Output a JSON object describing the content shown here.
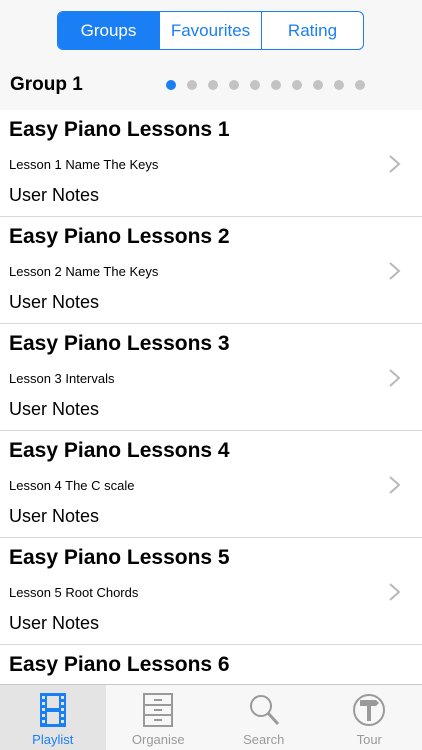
{
  "segments": [
    {
      "label": "Groups",
      "active": true
    },
    {
      "label": "Favourites",
      "active": false
    },
    {
      "label": "Rating",
      "active": false
    }
  ],
  "group": {
    "title": "Group 1",
    "page_count": 10,
    "current_page": 1
  },
  "lessons": [
    {
      "title": "Easy Piano Lessons 1",
      "subtitle": "Lesson 1 Name The Keys",
      "notes": "User Notes"
    },
    {
      "title": "Easy Piano Lessons 2",
      "subtitle": "Lesson 2 Name The Keys",
      "notes": "User Notes"
    },
    {
      "title": "Easy Piano Lessons 3",
      "subtitle": "Lesson 3 Intervals",
      "notes": "User Notes"
    },
    {
      "title": "Easy Piano Lessons 4",
      "subtitle": "Lesson 4 The C scale",
      "notes": "User Notes"
    },
    {
      "title": "Easy Piano Lessons 5",
      "subtitle": "Lesson 5 Root Chords",
      "notes": "User Notes"
    },
    {
      "title": "Easy Piano Lessons 6"
    }
  ],
  "tabs": [
    {
      "label": "Playlist",
      "icon": "film-strip-icon",
      "active": true
    },
    {
      "label": "Organise",
      "icon": "cabinet-icon",
      "active": false
    },
    {
      "label": "Search",
      "icon": "magnifier-icon",
      "active": false
    },
    {
      "label": "Tour",
      "icon": "signpost-icon",
      "active": false
    }
  ],
  "colors": {
    "accent": "#1a7ef5",
    "inactive": "#9a9a9a",
    "dot_inactive": "#c3c3c3"
  }
}
